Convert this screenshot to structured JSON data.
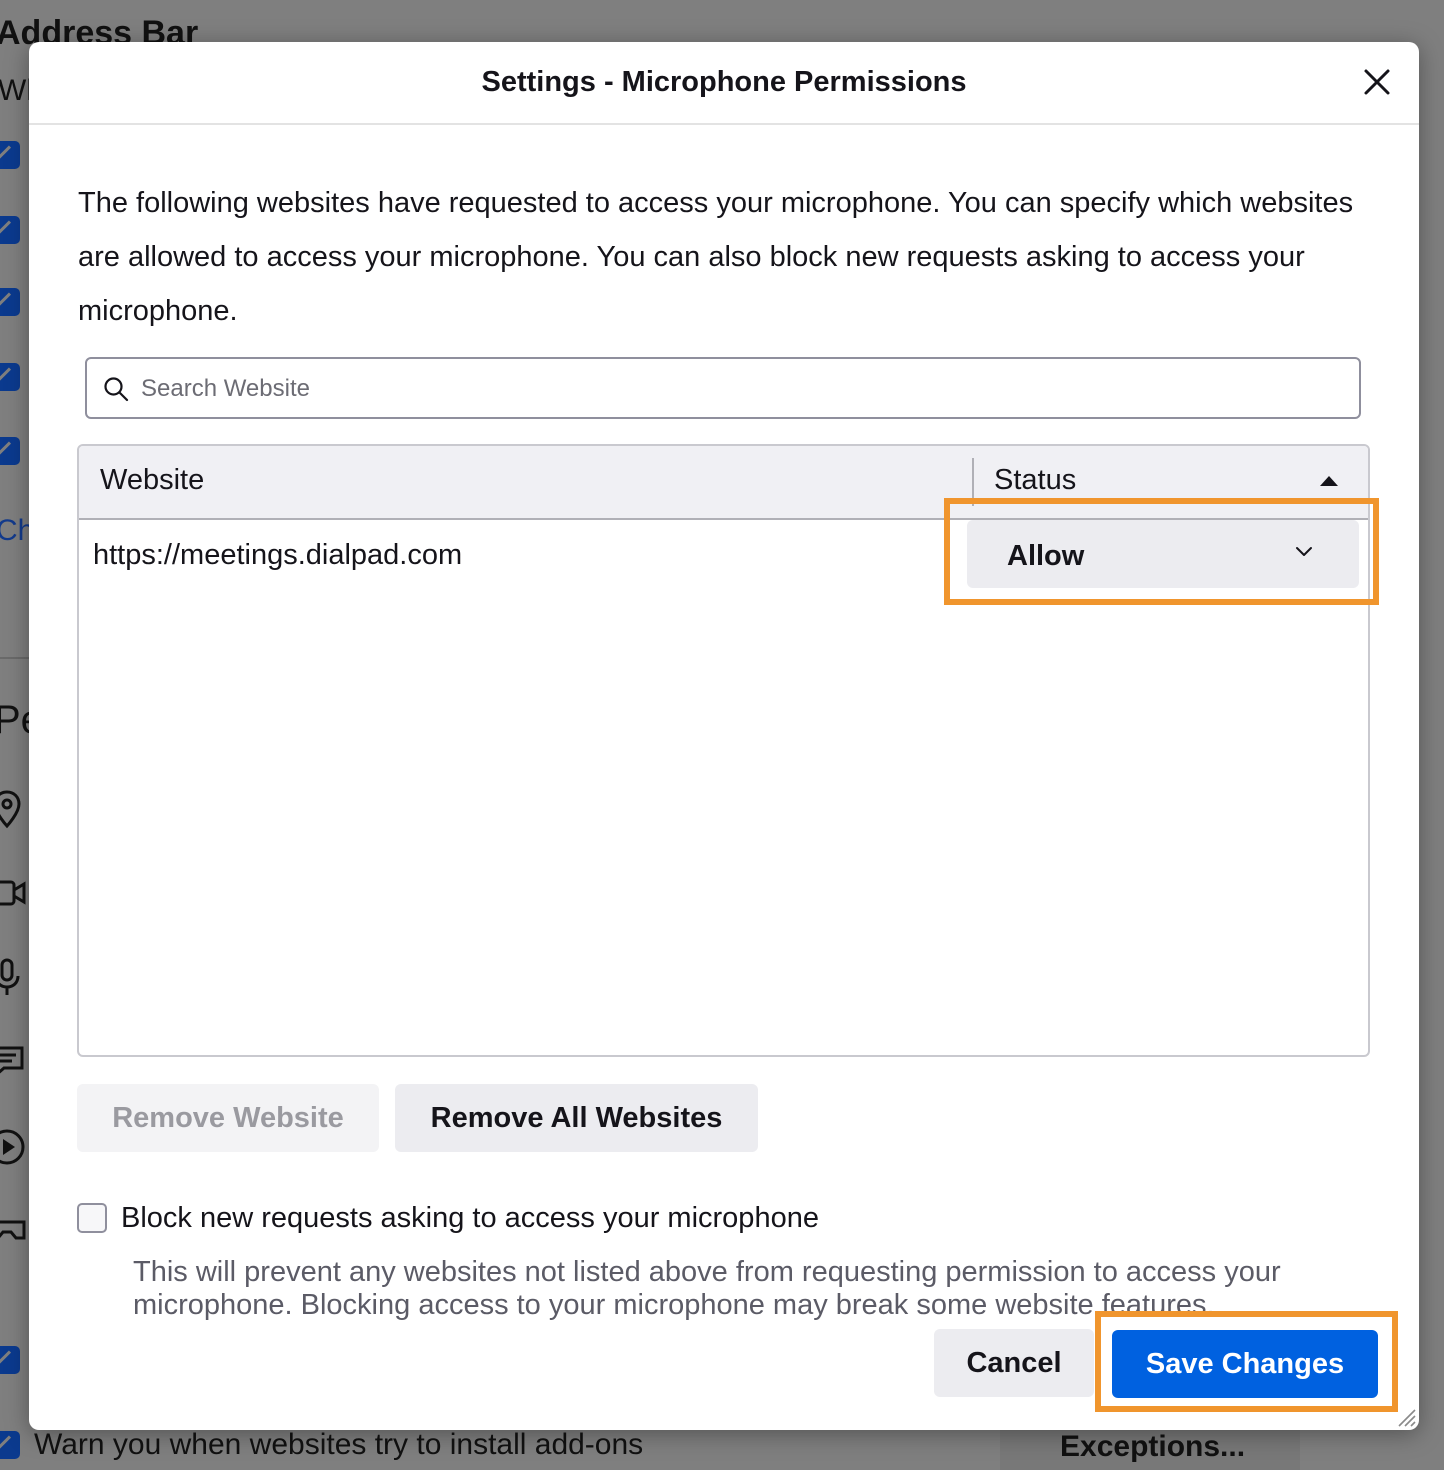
{
  "background": {
    "heading": "Address Bar",
    "subtext": "Wh",
    "link": "Cha",
    "section": "Pe",
    "bottom_checkbox_label": "Warn you when websites try to install add-ons",
    "exceptions_button": "Exceptions..."
  },
  "dialog": {
    "title": "Settings - Microphone Permissions",
    "description": "The following websites have requested to access your microphone. You can specify which websites are allowed to access your microphone. You can also block new requests asking to access your microphone.",
    "search": {
      "placeholder": "Search Website",
      "value": ""
    },
    "table": {
      "columns": [
        "Website",
        "Status"
      ],
      "sort": "Status ascending",
      "rows": [
        {
          "website": "https://meetings.dialpad.com",
          "status": "Allow"
        }
      ]
    },
    "buttons": {
      "remove_website": "Remove Website",
      "remove_all": "Remove All Websites",
      "cancel": "Cancel",
      "save": "Save Changes"
    },
    "block_checkbox": {
      "label": "Block new requests asking to access your microphone",
      "checked": false,
      "note": "This will prevent any websites not listed above from requesting permission to access your microphone. Blocking access to your microphone may break some website features."
    }
  },
  "colors": {
    "accent": "#0061e0",
    "highlight": "#f0952d",
    "overlay": "#7f7f7f"
  },
  "icons": [
    "search-icon",
    "close-icon",
    "chevron-down-icon",
    "sort-ascending-icon",
    "resize-grip-icon"
  ]
}
